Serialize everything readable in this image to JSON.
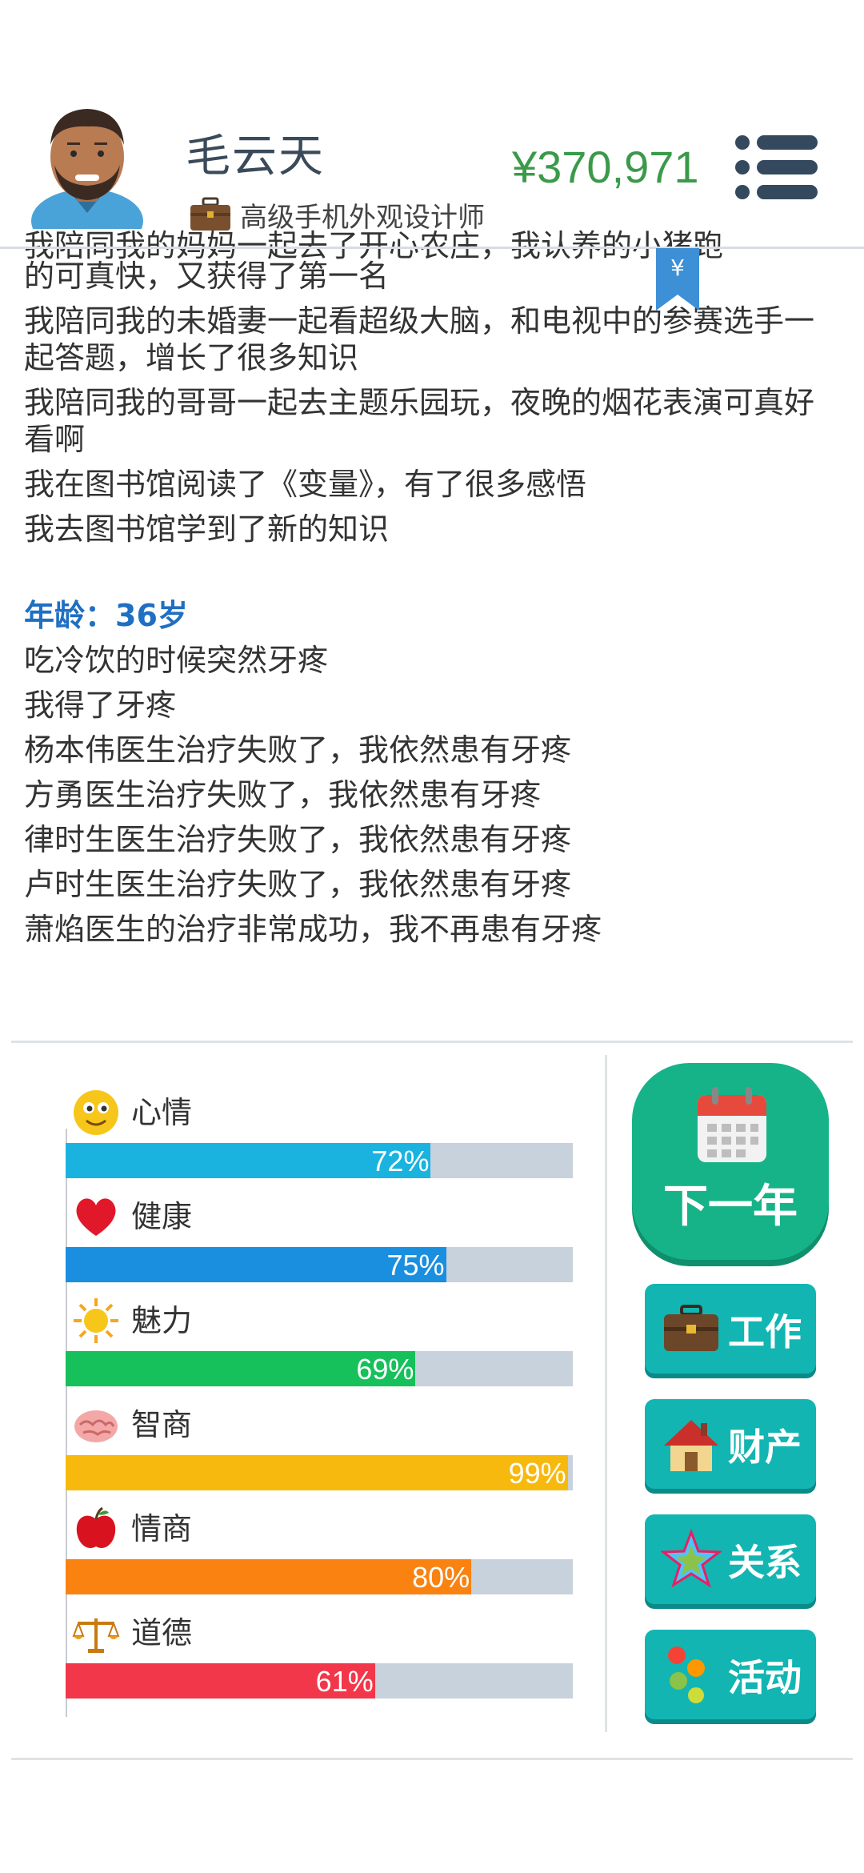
{
  "header": {
    "name": "毛云天",
    "job_title": "高级手机外观设计师",
    "money": "¥370,971"
  },
  "log": {
    "partial_top": "我陪同我的妈妈一起去了开心农庄，我认养的小猪跑",
    "entries": [
      "的可真快，又获得了第一名",
      "我陪同我的未婚妻一起看超级大脑，和电视中的参赛选手一起答题，增长了很多知识",
      "我陪同我的哥哥一起去主题乐园玩，夜晚的烟花表演可真好看啊",
      "我在图书馆阅读了《变量》，有了很多感悟",
      "我去图书馆学到了新的知识"
    ],
    "age_heading": "年龄：36岁",
    "age_entries": [
      "吃冷饮的时候突然牙疼",
      "我得了牙疼",
      "杨本伟医生治疗失败了，我依然患有牙疼",
      "方勇医生治疗失败了，我依然患有牙疼",
      "律时生医生治疗失败了，我依然患有牙疼",
      "卢时生医生治疗失败了，我依然患有牙疼",
      "萧焰医生的治疗非常成功，我不再患有牙疼"
    ]
  },
  "stats": [
    {
      "label": "心情",
      "percent_text": "72%",
      "value": 0.72,
      "color": "#1ab3e0",
      "icon": "smiley-icon"
    },
    {
      "label": "健康",
      "percent_text": "75%",
      "value": 0.75,
      "color": "#1a8fe0",
      "icon": "heart-icon"
    },
    {
      "label": "魅力",
      "percent_text": "69%",
      "value": 0.69,
      "color": "#16c05a",
      "icon": "sun-icon"
    },
    {
      "label": "智商",
      "percent_text": "99%",
      "value": 0.99,
      "color": "#f7b90e",
      "icon": "brain-icon"
    },
    {
      "label": "情商",
      "percent_text": "80%",
      "value": 0.8,
      "color": "#fa8210",
      "icon": "apple-icon"
    },
    {
      "label": "道德",
      "percent_text": "61%",
      "value": 0.61,
      "color": "#f2374a",
      "icon": "scales-icon"
    }
  ],
  "actions": {
    "next_year": "下一年",
    "work": "工作",
    "property": "财产",
    "relations": "关系",
    "activities": "活动"
  }
}
